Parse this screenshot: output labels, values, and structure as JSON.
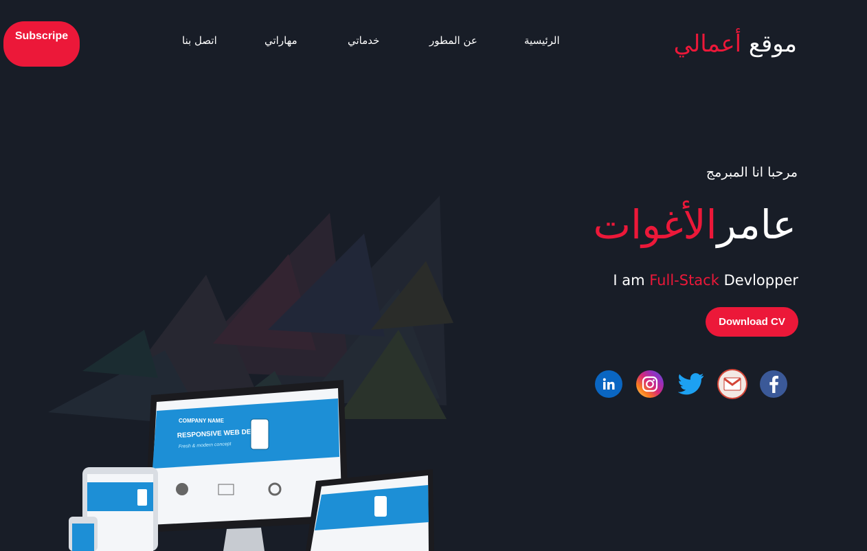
{
  "header": {
    "subscribe_label": "Subscripe",
    "nav": [
      "اتصل بنا",
      "مهاراتي",
      "خدماتي",
      "عن المطور",
      "الرئيسية"
    ],
    "logo_main": "موقع",
    "logo_accent": "أعمالي"
  },
  "hero": {
    "greeting": "مرحبا انا المبرمج",
    "name_main": "عامر",
    "name_accent": "الأغوات",
    "role_prefix": "I am",
    "role_accent": "Full-Stack",
    "role_suffix": "Devlopper",
    "cv_button": "Download CV"
  },
  "social": [
    {
      "icon": "linkedin-icon",
      "color": "#0a66c2"
    },
    {
      "icon": "instagram-icon",
      "color": "#d62976"
    },
    {
      "icon": "twitter-icon",
      "color": "#1da1f2"
    },
    {
      "icon": "gmail-icon",
      "color": "#d44638"
    },
    {
      "icon": "facebook-icon",
      "color": "#3b5998"
    }
  ],
  "devices": {
    "company": "COMPANY NAME",
    "headline": "RESPONSIVE WEB DESIGN",
    "sub": "Fresh & modern concept"
  },
  "colors": {
    "accent": "#ec1839",
    "background": "#181d27"
  }
}
